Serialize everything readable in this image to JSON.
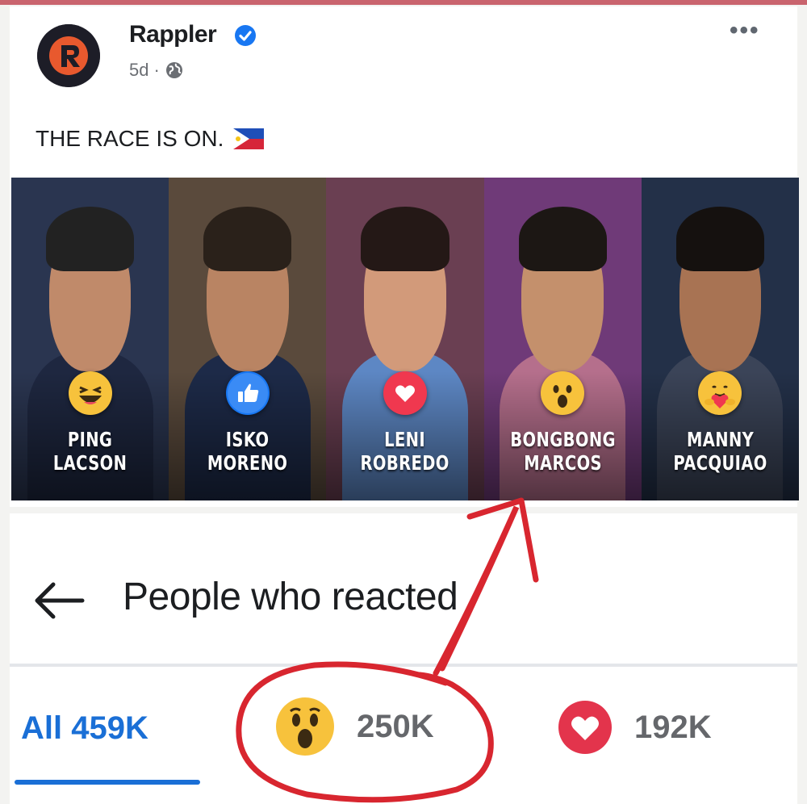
{
  "post": {
    "page_name": "Rappler",
    "time": "5d",
    "separator": "·",
    "caption": "THE RACE IS ON.",
    "more": "•••"
  },
  "candidates": [
    {
      "first": "PING",
      "last": "LACSON",
      "reaction": "haha-icon"
    },
    {
      "first": "ISKO",
      "last": "MORENO",
      "reaction": "like-icon"
    },
    {
      "first": "LENI",
      "last": "ROBREDO",
      "reaction": "love-icon"
    },
    {
      "first": "BONGBONG",
      "last": "MARCOS",
      "reaction": "wow-icon"
    },
    {
      "first": "MANNY",
      "last": "PACQUIAO",
      "reaction": "care-icon"
    }
  ],
  "reactions": {
    "title": "People who reacted",
    "tabs": [
      {
        "label": "All 459K",
        "selected": true
      },
      {
        "icon": "wow-icon",
        "count": "250K"
      },
      {
        "icon": "love-icon",
        "count": "192K"
      }
    ]
  },
  "colors": {
    "accent": "#1a6fd6",
    "annotation": "#d8262f",
    "love": "#f0384f",
    "like": "#1877f2",
    "emoji": "#f7c23c"
  }
}
